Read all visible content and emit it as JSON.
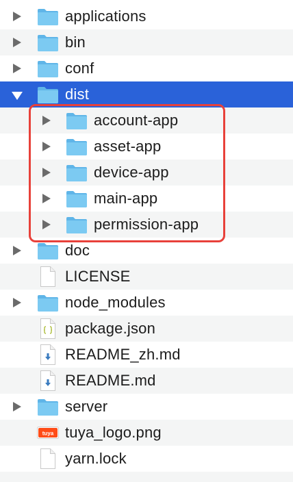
{
  "tree": {
    "items": [
      {
        "label": "applications",
        "type": "folder",
        "expanded": false,
        "depth": 0
      },
      {
        "label": "bin",
        "type": "folder",
        "expanded": false,
        "depth": 0
      },
      {
        "label": "conf",
        "type": "folder",
        "expanded": false,
        "depth": 0
      },
      {
        "label": "dist",
        "type": "folder",
        "expanded": true,
        "depth": 0,
        "selected": true
      },
      {
        "label": "account-app",
        "type": "folder",
        "expanded": false,
        "depth": 1
      },
      {
        "label": "asset-app",
        "type": "folder",
        "expanded": false,
        "depth": 1
      },
      {
        "label": "device-app",
        "type": "folder",
        "expanded": false,
        "depth": 1
      },
      {
        "label": "main-app",
        "type": "folder",
        "expanded": false,
        "depth": 1
      },
      {
        "label": "permission-app",
        "type": "folder",
        "expanded": false,
        "depth": 1
      },
      {
        "label": "doc",
        "type": "folder",
        "expanded": false,
        "depth": 0
      },
      {
        "label": "LICENSE",
        "type": "file-plain",
        "depth": 0
      },
      {
        "label": "node_modules",
        "type": "folder",
        "expanded": false,
        "depth": 0
      },
      {
        "label": "package.json",
        "type": "file-json",
        "depth": 0
      },
      {
        "label": "README_zh.md",
        "type": "file-markdown",
        "depth": 0
      },
      {
        "label": "README.md",
        "type": "file-markdown",
        "depth": 0
      },
      {
        "label": "server",
        "type": "folder",
        "expanded": false,
        "depth": 0
      },
      {
        "label": "tuya_logo.png",
        "type": "file-image",
        "depth": 0,
        "image_text": "tuya"
      },
      {
        "label": "yarn.lock",
        "type": "file-plain",
        "depth": 0
      }
    ]
  },
  "colors": {
    "selection": "#2a62d9",
    "highlight_border": "#e8413a",
    "folder": "#6cc0ef",
    "folder_tab": "#5fb5e8",
    "alt_row": "#f4f5f5"
  }
}
